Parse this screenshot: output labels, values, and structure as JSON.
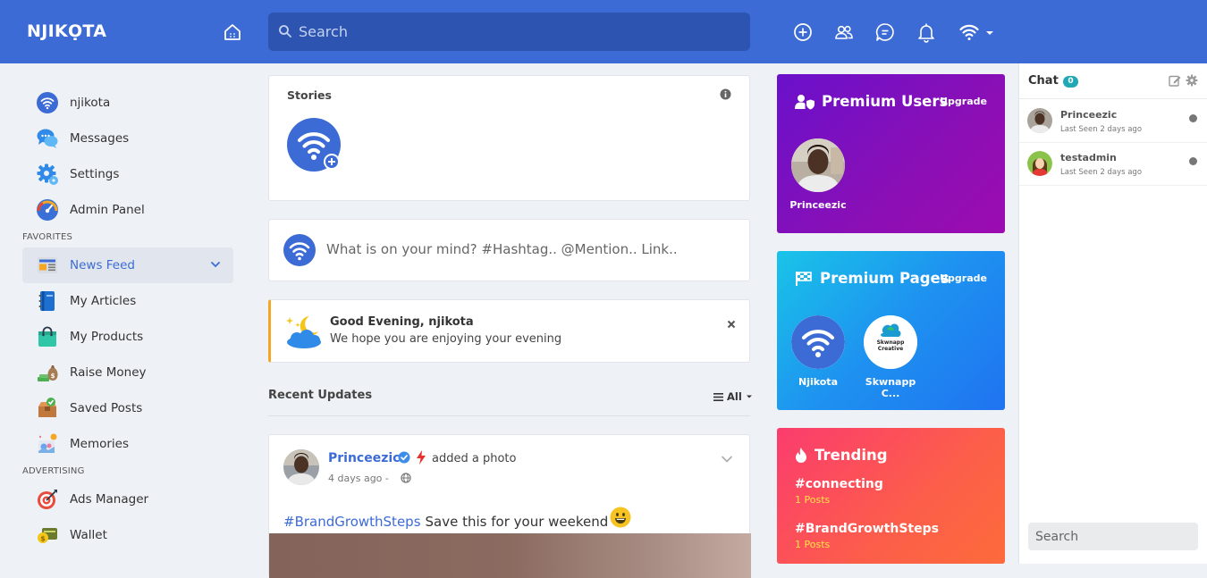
{
  "header": {
    "logo": "NJIKỌTA",
    "search_placeholder": "Search",
    "icons": [
      "home-icon",
      "create-icon",
      "friends-icon",
      "messages-icon",
      "notifications-icon",
      "profile-menu-icon"
    ],
    "brand_color": "#3c6bd6"
  },
  "sidebar": {
    "items": [
      {
        "label": "njikota",
        "icon": "profile-wifi-icon"
      },
      {
        "label": "Messages",
        "icon": "chat-bubbles-icon"
      },
      {
        "label": "Settings",
        "icon": "gear-icon"
      },
      {
        "label": "Admin Panel",
        "icon": "dashboard-icon"
      }
    ],
    "favorites_label": "FAVORITES",
    "favorites": [
      {
        "label": "News Feed",
        "icon": "newspaper-icon",
        "active": true
      },
      {
        "label": "My Articles",
        "icon": "notebook-icon"
      },
      {
        "label": "My Products",
        "icon": "shopping-bag-icon"
      },
      {
        "label": "Raise Money",
        "icon": "money-bag-icon"
      },
      {
        "label": "Saved Posts",
        "icon": "saved-box-icon"
      },
      {
        "label": "Memories",
        "icon": "memories-icon"
      }
    ],
    "advertising_label": "ADVERTISING",
    "advertising": [
      {
        "label": "Ads Manager",
        "icon": "target-icon"
      },
      {
        "label": "Wallet",
        "icon": "wallet-icon"
      }
    ]
  },
  "stories": {
    "title": "Stories"
  },
  "composer": {
    "placeholder": "What is on your mind? #Hashtag.. @Mention.. Link.."
  },
  "greeting": {
    "title": "Good Evening, njikota",
    "message": "We hope you are enjoying your evening"
  },
  "recent": {
    "title": "Recent Updates",
    "filter": "All"
  },
  "post": {
    "author": "Princeezic",
    "action": "added a photo",
    "time": "4 days ago -",
    "hashtag": "#BrandGrowthSteps",
    "text": "Save this for your weekend"
  },
  "premium_users": {
    "title": "Premium Users",
    "upgrade": "Upgrade",
    "users": [
      {
        "name": "Princeezic"
      }
    ]
  },
  "premium_pages": {
    "title": "Premium Pages",
    "upgrade": "Upgrade",
    "pages": [
      {
        "name": "Njikota",
        "logo_text": ""
      },
      {
        "name": "Skwnapp C...",
        "logo_text": "Skwnapp Creative"
      }
    ]
  },
  "trending": {
    "title": "Trending",
    "items": [
      {
        "tag": "#connecting",
        "count": "1 Posts"
      },
      {
        "tag": "#BrandGrowthSteps",
        "count": "1 Posts"
      }
    ]
  },
  "chat": {
    "title": "Chat",
    "badge": "0",
    "users": [
      {
        "name": "Princeezic",
        "seen": "Last Seen 2 days ago"
      },
      {
        "name": "testadmin",
        "seen": "Last Seen 2 days ago"
      }
    ],
    "search_placeholder": "Search"
  }
}
